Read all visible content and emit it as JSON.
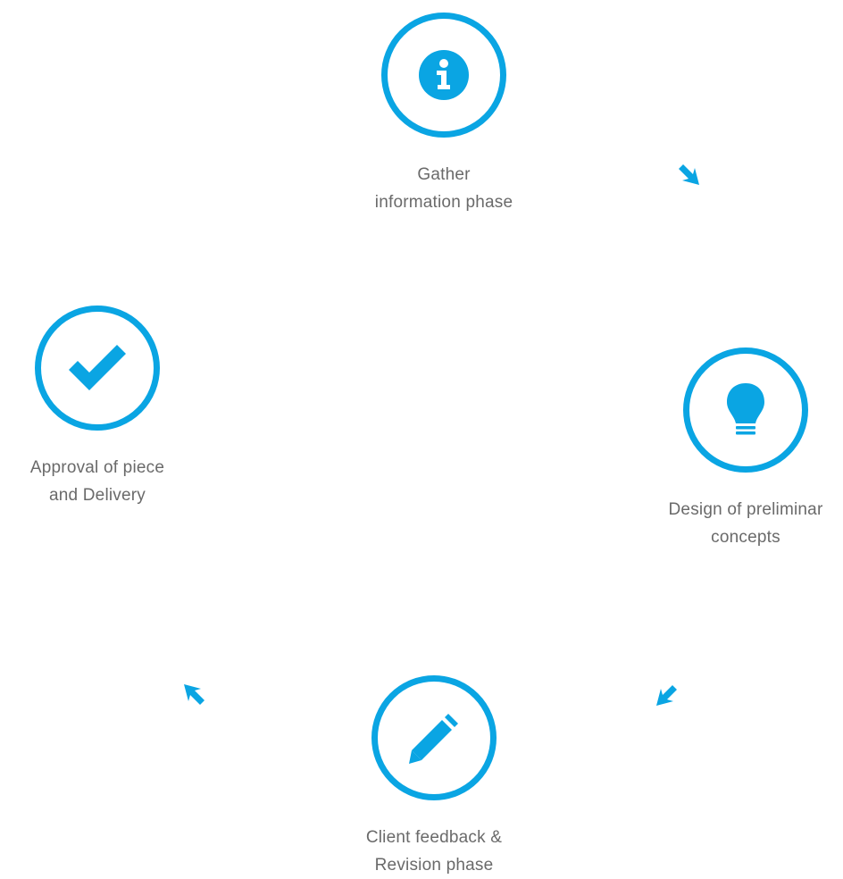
{
  "accent_color": "#0aa5e3",
  "text_color": "#6a6a6a",
  "steps": [
    {
      "icon": "info-icon",
      "label_line1": "Gather",
      "label_line2": "information phase"
    },
    {
      "icon": "lightbulb-icon",
      "label_line1": "Design of preliminar",
      "label_line2": "concepts"
    },
    {
      "icon": "pencil-icon",
      "label_line1": "Client feedback &",
      "label_line2": "Revision phase"
    },
    {
      "icon": "checkmark-icon",
      "label_line1": "Approval of piece",
      "label_line2": "and Delivery"
    }
  ],
  "arrows": [
    {
      "icon": "arrow-down-right-icon"
    },
    {
      "icon": "arrow-down-left-icon"
    },
    {
      "icon": "arrow-up-left-icon"
    }
  ]
}
